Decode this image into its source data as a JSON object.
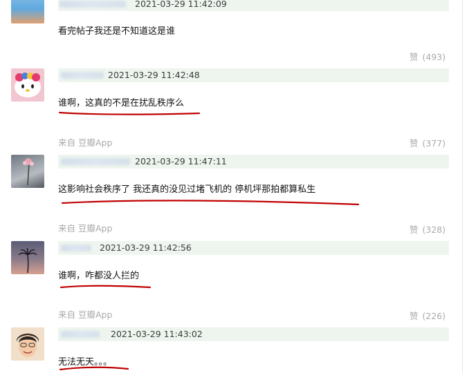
{
  "comments": [
    {
      "time": "2021-03-29 11:42:09",
      "text": "看完帖子我还是不知道这是谁",
      "source": "",
      "likes_label": "赞",
      "likes_count": "(493)"
    },
    {
      "time": "2021-03-29 11:42:48",
      "text": "谁啊，这真的不是在扰乱秩序么",
      "source": "来自 豆瓣App",
      "likes_label": "赞",
      "likes_count": "(377)"
    },
    {
      "time": "2021-03-29 11:47:11",
      "text": "这影响社会秩序了 我还真的没见过堵飞机的 停机坪那拍都算私生",
      "source": "来自 豆瓣App",
      "likes_label": "赞",
      "likes_count": "(328)"
    },
    {
      "time": "2021-03-29 11:42:56",
      "text": "谁啊，咋都没人拦的",
      "source": "来自 豆瓣App",
      "likes_label": "赞",
      "likes_count": "(226)"
    },
    {
      "time": "2021-03-29 11:43:02",
      "text": "无法无天。。。",
      "source": "",
      "likes_label": "",
      "likes_count": ""
    }
  ],
  "colors": {
    "meta_bar": "#eef5ef",
    "muted_text": "#aaaaaa",
    "annotation_ink": "#c00000"
  }
}
